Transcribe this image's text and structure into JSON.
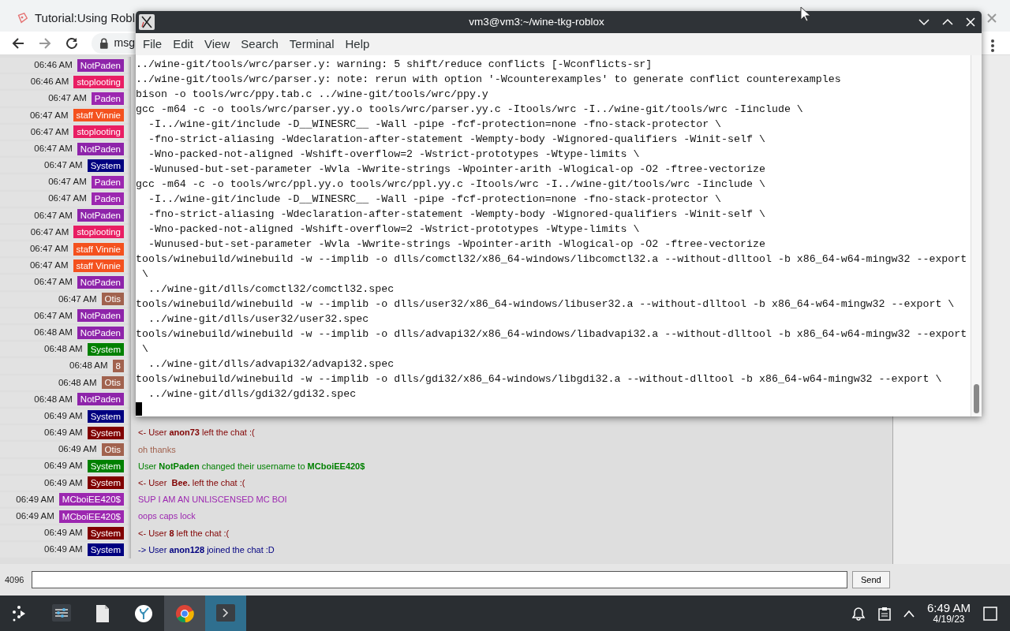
{
  "browser": {
    "tabs": [
      {
        "label": "Tutorial:Using Robl",
        "selected": true
      }
    ],
    "address": "msg",
    "chat": {
      "rows": [
        {
          "time": "06:46 AM",
          "user": "NotPaden",
          "color": "#8e24aa"
        },
        {
          "time": "06:46 AM",
          "user": "stoplooting",
          "color": "#e91e63"
        },
        {
          "time": "06:47 AM",
          "user": "Paden",
          "color": "#9c27b0"
        },
        {
          "time": "06:47 AM",
          "user": "staff Vinnie",
          "color": "#f4511e"
        },
        {
          "time": "06:47 AM",
          "user": "stoplooting",
          "color": "#e91e63"
        },
        {
          "time": "06:47 AM",
          "user": "NotPaden",
          "color": "#8e24aa"
        },
        {
          "time": "06:47 AM",
          "user": "System",
          "color": "#000080"
        },
        {
          "time": "06:47 AM",
          "user": "Paden",
          "color": "#9c27b0"
        },
        {
          "time": "06:47 AM",
          "user": "Paden",
          "color": "#9c27b0"
        },
        {
          "time": "06:47 AM",
          "user": "NotPaden",
          "color": "#8e24aa"
        },
        {
          "time": "06:47 AM",
          "user": "stoplooting",
          "color": "#e91e63"
        },
        {
          "time": "06:47 AM",
          "user": "staff Vinnie",
          "color": "#f4511e"
        },
        {
          "time": "06:47 AM",
          "user": "staff Vinnie",
          "color": "#f4511e"
        },
        {
          "time": "06:47 AM",
          "user": "NotPaden",
          "color": "#8e24aa"
        },
        {
          "time": "06:47 AM",
          "user": "Otis",
          "color": "#a1624e"
        },
        {
          "time": "06:47 AM",
          "user": "NotPaden",
          "color": "#8e24aa"
        },
        {
          "time": "06:48 AM",
          "user": "NotPaden",
          "color": "#8e24aa"
        },
        {
          "time": "06:48 AM",
          "user": "System",
          "color": "#008000"
        },
        {
          "time": "06:48 AM",
          "user": "8",
          "color": "#a1624e"
        },
        {
          "time": "06:48 AM",
          "user": "Otis",
          "color": "#a1624e"
        },
        {
          "time": "06:48 AM",
          "user": "NotPaden",
          "color": "#8e24aa"
        },
        {
          "time": "06:49 AM",
          "user": "System",
          "color": "#000080"
        },
        {
          "time": "06:49 AM",
          "user": "System",
          "color": "#800000",
          "message": "<- User **anon73** left the chat :("
        },
        {
          "time": "06:49 AM",
          "user": "Otis",
          "color": "#a1624e",
          "message": "oh thanks"
        },
        {
          "time": "06:49 AM",
          "user": "System",
          "color": "#008000",
          "message": "User **NotPaden** changed their username to **MCboiEE420$**"
        },
        {
          "time": "06:49 AM",
          "user": "System",
          "color": "#800000",
          "message": "<- User  **Bee.** left the chat :("
        },
        {
          "time": "06:49 AM",
          "user": "MCboiEE420$",
          "color": "#9c27b0",
          "message": "SUP I AM AN UNLISCENSED MC BOI"
        },
        {
          "time": "06:49 AM",
          "user": "MCboiEE420$",
          "color": "#9c27b0",
          "message": "oops caps lock"
        },
        {
          "time": "06:49 AM",
          "user": "System",
          "color": "#800000",
          "message": "<- User **8** left the chat :("
        },
        {
          "time": "06:49 AM",
          "user": "System",
          "color": "#000080",
          "message": "-> User **anon128** joined the chat :D"
        }
      ]
    },
    "input": {
      "counter": "4096",
      "send": "Send"
    }
  },
  "terminal": {
    "title": "vm3@vm3:~/wine-tkg-roblox",
    "menu": [
      "File",
      "Edit",
      "View",
      "Search",
      "Terminal",
      "Help"
    ],
    "lines": [
      "../wine-git/tools/wrc/parser.y: warning: 5 shift/reduce conflicts [-Wconflicts-sr]",
      "../wine-git/tools/wrc/parser.y: note: rerun with option '-Wcounterexamples' to generate conflict counterexamples",
      "bison -o tools/wrc/ppy.tab.c ../wine-git/tools/wrc/ppy.y",
      "gcc -m64 -c -o tools/wrc/parser.yy.o tools/wrc/parser.yy.c -Itools/wrc -I../wine-git/tools/wrc -Iinclude \\",
      "  -I../wine-git/include -D__WINESRC__ -Wall -pipe -fcf-protection=none -fno-stack-protector \\",
      "  -fno-strict-aliasing -Wdeclaration-after-statement -Wempty-body -Wignored-qualifiers -Winit-self \\",
      "  -Wno-packed-not-aligned -Wshift-overflow=2 -Wstrict-prototypes -Wtype-limits \\",
      "  -Wunused-but-set-parameter -Wvla -Wwrite-strings -Wpointer-arith -Wlogical-op -O2 -ftree-vectorize",
      "gcc -m64 -c -o tools/wrc/ppl.yy.o tools/wrc/ppl.yy.c -Itools/wrc -I../wine-git/tools/wrc -Iinclude \\",
      "  -I../wine-git/include -D__WINESRC__ -Wall -pipe -fcf-protection=none -fno-stack-protector \\",
      "  -fno-strict-aliasing -Wdeclaration-after-statement -Wempty-body -Wignored-qualifiers -Winit-self \\",
      "  -Wno-packed-not-aligned -Wshift-overflow=2 -Wstrict-prototypes -Wtype-limits \\",
      "  -Wunused-but-set-parameter -Wvla -Wwrite-strings -Wpointer-arith -Wlogical-op -O2 -ftree-vectorize",
      "tools/winebuild/winebuild -w --implib -o dlls/comctl32/x86_64-windows/libcomctl32.a --without-dlltool -b x86_64-w64-mingw32 --export",
      " \\",
      "  ../wine-git/dlls/comctl32/comctl32.spec",
      "tools/winebuild/winebuild -w --implib -o dlls/user32/x86_64-windows/libuser32.a --without-dlltool -b x86_64-w64-mingw32 --export \\",
      "  ../wine-git/dlls/user32/user32.spec",
      "tools/winebuild/winebuild -w --implib -o dlls/advapi32/x86_64-windows/libadvapi32.a --without-dlltool -b x86_64-w64-mingw32 --export",
      " \\",
      "  ../wine-git/dlls/advapi32/advapi32.spec",
      "tools/winebuild/winebuild -w --implib -o dlls/gdi32/x86_64-windows/libgdi32.a --without-dlltool -b x86_64-w64-mingw32 --export \\",
      "  ../wine-git/dlls/gdi32/gdi32.spec"
    ]
  },
  "taskbar": {
    "apps": [
      {
        "kind": "launcher",
        "open": false,
        "focused": false
      },
      {
        "kind": "settings",
        "open": false,
        "focused": false
      },
      {
        "kind": "files",
        "open": false,
        "focused": false
      },
      {
        "kind": "coral",
        "open": false,
        "focused": false
      },
      {
        "kind": "chrome",
        "open": true,
        "focused": false
      },
      {
        "kind": "terminal",
        "open": true,
        "focused": true
      }
    ],
    "clock": {
      "time": "6:49 AM",
      "date": "4/19/23"
    }
  }
}
